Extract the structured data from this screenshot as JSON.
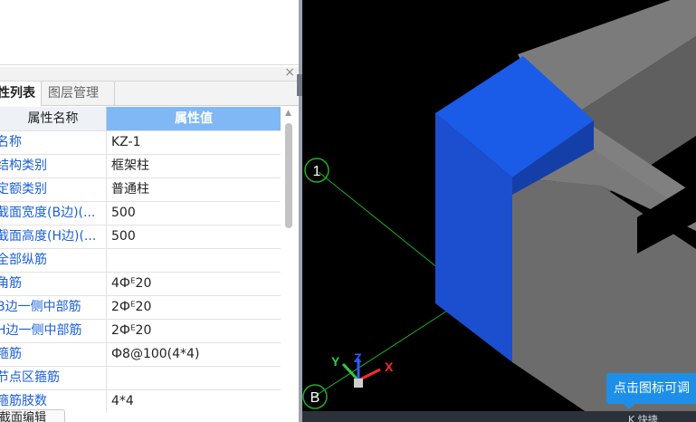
{
  "panel": {
    "close_glyph": "×",
    "tabs": [
      {
        "label": "性列表"
      },
      {
        "label": "图层管理"
      }
    ],
    "header": {
      "name": "属性名称",
      "value": "属性值"
    },
    "rows": [
      {
        "name": "名称",
        "value": "KZ-1"
      },
      {
        "name": "结构类别",
        "value": "框架柱"
      },
      {
        "name": "定额类别",
        "value": "普通柱"
      },
      {
        "name": "截面宽度(B边)(...",
        "value": "500"
      },
      {
        "name": "截面高度(H边)(...",
        "value": "500"
      },
      {
        "name": "全部纵筋",
        "value": ""
      },
      {
        "name": "角筋",
        "value": "4Фᴱ20"
      },
      {
        "name": "B边一侧中部筋",
        "value": "2Фᴱ20"
      },
      {
        "name": "H边一侧中部筋",
        "value": "2Фᴱ20"
      },
      {
        "name": "箍筋",
        "value": "Ф8@100(4*4)"
      },
      {
        "name": "节点区箍筋",
        "value": ""
      },
      {
        "name": "箍筋肢数",
        "value": "4*4"
      }
    ],
    "bottom_button": "截面编辑"
  },
  "viewport": {
    "axis_labels": {
      "grid_1": "1",
      "grid_b": "B"
    },
    "gizmo": {
      "x": "X",
      "y": "Y",
      "z": "Z"
    },
    "tooltip": "点击图标可调",
    "status_text": "K 快捷"
  },
  "colors": {
    "column_top": "#1a5ce8",
    "column_front": "#1c4fd0",
    "column_side": "#153fa8",
    "beam_top": "#7b7b7b",
    "beam_side": "#666666",
    "grid_line": "#1fae2a",
    "accent": "#1d8fe8"
  }
}
